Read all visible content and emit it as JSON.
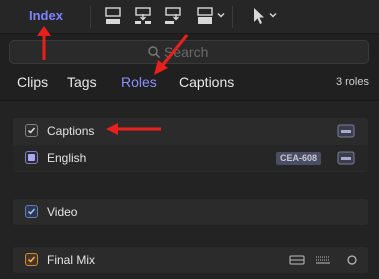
{
  "toolbar": {
    "index_label": "Index",
    "buttons": [
      {
        "icon": "connect-clip-icon"
      },
      {
        "icon": "insert-clip-icon"
      },
      {
        "icon": "append-clip-icon"
      },
      {
        "icon": "overwrite-clip-icon"
      },
      {
        "icon": "select-tool-icon"
      }
    ]
  },
  "search": {
    "placeholder": "Search",
    "value": ""
  },
  "tabs": [
    {
      "label": "Clips",
      "active": false
    },
    {
      "label": "Tags",
      "active": false
    },
    {
      "label": "Roles",
      "active": true
    },
    {
      "label": "Captions",
      "active": false
    }
  ],
  "roles_count": "3 roles",
  "roles": [
    {
      "label": "Captions",
      "checkbox": "checked-gray",
      "subroles": [
        {
          "label": "English",
          "badge": "CEA-608",
          "checkbox": "partial-purple"
        }
      ]
    },
    {
      "label": "Video",
      "checkbox": "checked-blue"
    },
    {
      "label": "Final Mix",
      "checkbox": "checked-orange"
    }
  ],
  "colors": {
    "accent": "#8d8fff",
    "annotation_arrow": "#e8201c",
    "video_role": "#5e80b5",
    "audio_role": "#c98a3c"
  }
}
